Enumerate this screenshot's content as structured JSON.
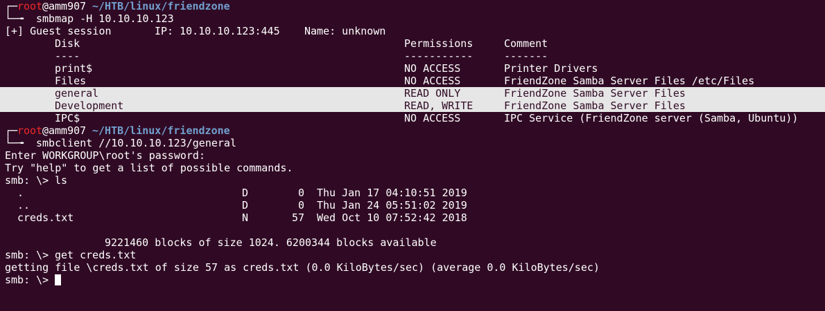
{
  "prompt": {
    "user": "root",
    "at": "@",
    "host": "amm907",
    "path": "~/HTB/linux/friendzone",
    "corner_top": "┌─",
    "corner_bottom": "└─╼",
    "arrow": "→"
  },
  "commands": {
    "smbmap": "smbmap -H 10.10.10.123",
    "smbclient": "smbclient //10.10.10.123/general"
  },
  "smbmap_output": {
    "session": "[+] Guest session",
    "ip": "IP: 10.10.10.123:445",
    "name": "Name: unknown",
    "headers": {
      "disk": "Disk",
      "permissions": "Permissions",
      "comment": "Comment"
    },
    "dividers": {
      "disk": "----",
      "permissions": "-----------",
      "comment": "-------"
    },
    "shares": [
      {
        "disk": "print$",
        "permissions": "NO ACCESS",
        "comment": "Printer Drivers"
      },
      {
        "disk": "Files",
        "permissions": "NO ACCESS",
        "comment": "FriendZone Samba Server Files /etc/Files"
      },
      {
        "disk": "general",
        "permissions": "READ ONLY",
        "comment": "FriendZone Samba Server Files"
      },
      {
        "disk": "Development",
        "permissions": "READ, WRITE",
        "comment": "FriendZone Samba Server Files"
      },
      {
        "disk": "IPC$",
        "permissions": "NO ACCESS",
        "comment": "IPC Service (FriendZone server (Samba, Ubuntu))"
      }
    ]
  },
  "smbclient_session": {
    "password_prompt": "Enter WORKGROUP\\root's password:",
    "help_hint": "Try \"help\" to get a list of possible commands.",
    "smb_prompt": "smb: \\>",
    "ls_cmd": "ls",
    "listing": [
      {
        "name": ".",
        "type": "D",
        "size": "0",
        "date": "Thu Jan 17 04:10:51 2019"
      },
      {
        "name": "..",
        "type": "D",
        "size": "0",
        "date": "Thu Jan 24 05:51:02 2019"
      },
      {
        "name": "creds.txt",
        "type": "N",
        "size": "57",
        "date": "Wed Oct 10 07:52:42 2018"
      }
    ],
    "blocks_info": "9221460 blocks of size 1024. 6200344 blocks available",
    "get_cmd": "get creds.txt",
    "get_result": "getting file \\creds.txt of size 57 as creds.txt (0.0 KiloBytes/sec) (average 0.0 KiloBytes/sec)"
  },
  "colors": {
    "background": "#300a24",
    "foreground": "#ffffff",
    "user": "#ef2929",
    "path": "#729fcf",
    "highlight_bg": "#e6e6e6"
  }
}
